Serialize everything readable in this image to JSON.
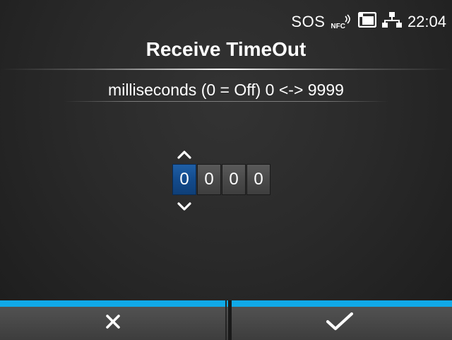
{
  "status_bar": {
    "sos": "SOS",
    "nfc": "NFC",
    "icons": [
      "nfc-icon",
      "sd-card-icon",
      "network-icon"
    ],
    "time": "22:04"
  },
  "title": "Receive TimeOut",
  "subtitle": "milliseconds (0 = Off) 0 <-> 9999",
  "stepper": {
    "digits": [
      "0",
      "0",
      "0",
      "0"
    ],
    "selected_index": 0,
    "up_icon": "chevron-up-icon",
    "down_icon": "chevron-down-icon"
  },
  "buttons": {
    "cancel_icon": "close-icon",
    "confirm_icon": "checkmark-icon"
  },
  "colors": {
    "accent": "#10a9e8",
    "selected_digit": "#134b8c"
  }
}
